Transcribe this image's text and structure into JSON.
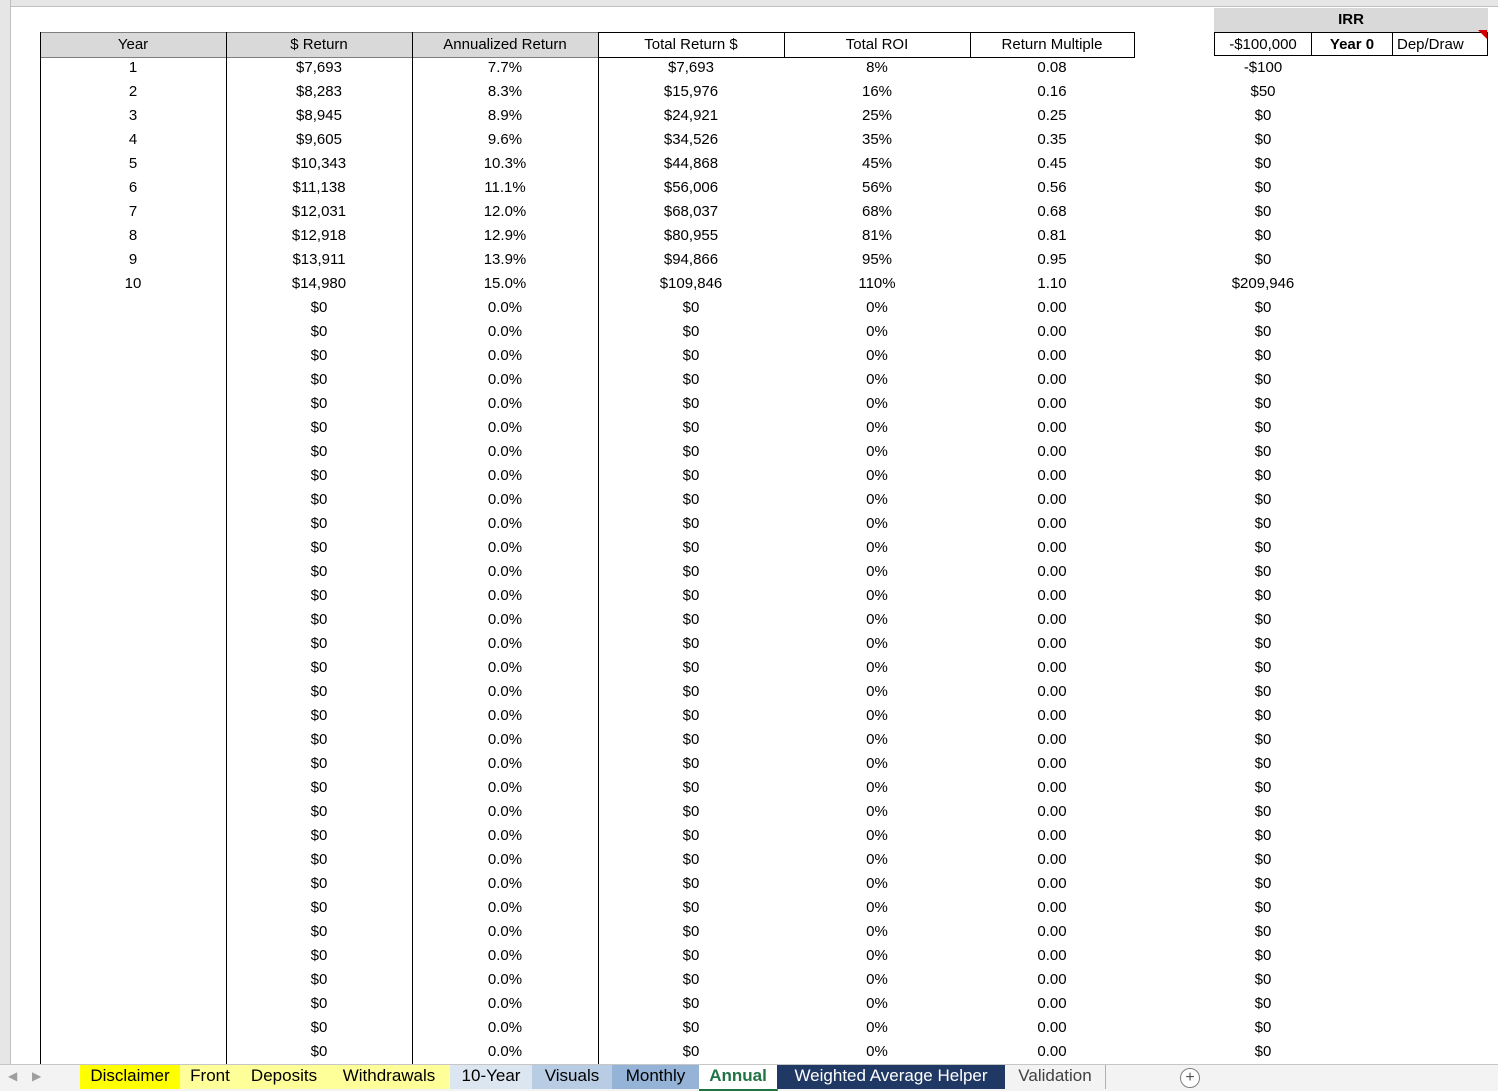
{
  "columns": {
    "year": "Year",
    "dollar_return": "$ Return",
    "annualized_return": "Annualized Return",
    "total_return": "Total Return $",
    "total_roi": "Total ROI",
    "return_multiple": "Return Multiple"
  },
  "irr": {
    "title": "IRR",
    "initial": "-$100,000",
    "year0_label": "Year 0",
    "depdraw_label": "Dep/Draw"
  },
  "rows": [
    {
      "year": "1",
      "ret": "$7,693",
      "ann": "7.7%",
      "tot": "$7,693",
      "roi": "8%",
      "mult": "0.08",
      "irr": "-$100"
    },
    {
      "year": "2",
      "ret": "$8,283",
      "ann": "8.3%",
      "tot": "$15,976",
      "roi": "16%",
      "mult": "0.16",
      "irr": "$50"
    },
    {
      "year": "3",
      "ret": "$8,945",
      "ann": "8.9%",
      "tot": "$24,921",
      "roi": "25%",
      "mult": "0.25",
      "irr": "$0"
    },
    {
      "year": "4",
      "ret": "$9,605",
      "ann": "9.6%",
      "tot": "$34,526",
      "roi": "35%",
      "mult": "0.35",
      "irr": "$0"
    },
    {
      "year": "5",
      "ret": "$10,343",
      "ann": "10.3%",
      "tot": "$44,868",
      "roi": "45%",
      "mult": "0.45",
      "irr": "$0"
    },
    {
      "year": "6",
      "ret": "$11,138",
      "ann": "11.1%",
      "tot": "$56,006",
      "roi": "56%",
      "mult": "0.56",
      "irr": "$0"
    },
    {
      "year": "7",
      "ret": "$12,031",
      "ann": "12.0%",
      "tot": "$68,037",
      "roi": "68%",
      "mult": "0.68",
      "irr": "$0"
    },
    {
      "year": "8",
      "ret": "$12,918",
      "ann": "12.9%",
      "tot": "$80,955",
      "roi": "81%",
      "mult": "0.81",
      "irr": "$0"
    },
    {
      "year": "9",
      "ret": "$13,911",
      "ann": "13.9%",
      "tot": "$94,866",
      "roi": "95%",
      "mult": "0.95",
      "irr": "$0"
    },
    {
      "year": "10",
      "ret": "$14,980",
      "ann": "15.0%",
      "tot": "$109,846",
      "roi": "110%",
      "mult": "1.10",
      "irr": "$209,946"
    }
  ],
  "empty_row": {
    "year": "",
    "ret": "$0",
    "ann": "0.0%",
    "tot": "$0",
    "roi": "0%",
    "mult": "0.00",
    "irr": "$0"
  },
  "empty_row_count": 32,
  "tabs": [
    {
      "label": "Disclaimer",
      "bg": "#ffff00",
      "color": "#000000"
    },
    {
      "label": "Front",
      "bg": "#ffff99",
      "color": "#000000"
    },
    {
      "label": "Deposits",
      "bg": "#ffff99",
      "color": "#000000"
    },
    {
      "label": "Withdrawals",
      "bg": "#ffff99",
      "color": "#000000"
    },
    {
      "label": "10-Year",
      "bg": "#dce6f1",
      "color": "#000000"
    },
    {
      "label": "Visuals",
      "bg": "#b8cce4",
      "color": "#000000"
    },
    {
      "label": "Monthly",
      "bg": "#95b3d7",
      "color": "#000000"
    },
    {
      "label": "Annual",
      "bg": "#ffffff",
      "color": "#217346",
      "active": true
    },
    {
      "label": "Weighted Average Helper",
      "bg": "#1f3864",
      "color": "#ffffff"
    },
    {
      "label": "Validation",
      "bg": "#f3f3f3",
      "color": "#404040"
    }
  ],
  "colors": {
    "header_bg": "#d9d9d9",
    "active_tab": "#217346"
  }
}
